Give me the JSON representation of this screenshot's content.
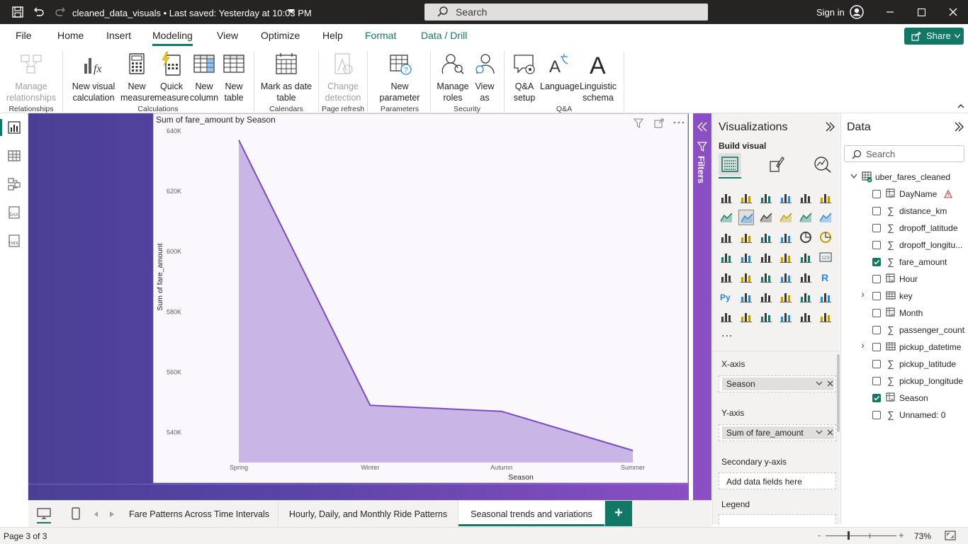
{
  "titlebar": {
    "title": "cleaned_data_visuals • Last saved: Yesterday at 10:03 PM",
    "search_placeholder": "Search",
    "signin": "Sign in"
  },
  "ribbon": {
    "tabs": [
      "File",
      "Home",
      "Insert",
      "Modeling",
      "View",
      "Optimize",
      "Help",
      "Format",
      "Data / Drill"
    ],
    "active_tab": "Modeling",
    "share": "Share",
    "buttons": {
      "manage_relationships": "Manage relationships",
      "new_visual_calc": "New visual calculation",
      "new_measure": "New measure",
      "quick_measure": "Quick measure",
      "new_column": "New column",
      "new_table": "New table",
      "mark_date": "Mark as date table",
      "change_detection": "Change detection",
      "new_parameter": "New parameter",
      "manage_roles": "Manage roles",
      "view_as": "View as",
      "qa_setup": "Q&A setup",
      "language": "Language",
      "linguistic_schema": "Linguistic schema"
    },
    "groups": {
      "relationships": "Relationships",
      "calculations": "Calculations",
      "calendars": "Calendars",
      "page_refresh": "Page refresh",
      "parameters": "Parameters",
      "security": "Security",
      "qa": "Q&A"
    }
  },
  "filters_label": "Filters",
  "chart_data": {
    "type": "area",
    "title": "Sum of fare_amount by Season",
    "xlabel": "Season",
    "ylabel": "Sum of fare_amount",
    "categories": [
      "Spring",
      "Winter",
      "Autumn",
      "Summer"
    ],
    "values": [
      637000,
      549000,
      547000,
      534000
    ],
    "ylim": [
      530000,
      640000
    ],
    "yticks": [
      540000,
      560000,
      580000,
      600000,
      620000,
      640000
    ],
    "ytick_labels": [
      "540K",
      "560K",
      "580K",
      "600K",
      "620K",
      "640K"
    ],
    "line_color": "#7b4bc4",
    "fill_color": "#c9b6e6",
    "grid": false
  },
  "visualizations": {
    "title": "Visualizations",
    "build_visual": "Build visual",
    "more": "...",
    "x_axis_label": "X-axis",
    "x_axis_field": "Season",
    "y_axis_label": "Y-axis",
    "y_axis_field": "Sum of fare_amount",
    "secondary_label": "Secondary y-axis",
    "secondary_placeholder": "Add data fields here",
    "legend_label": "Legend"
  },
  "data_pane": {
    "title": "Data",
    "search_placeholder": "Search",
    "table": "uber_fares_cleaned",
    "fields": [
      {
        "name": "DayName",
        "checked": false,
        "type": "calc"
      },
      {
        "name": "distance_km",
        "checked": false,
        "type": "sum"
      },
      {
        "name": "dropoff_latitude",
        "checked": false,
        "type": "sum"
      },
      {
        "name": "dropoff_longitu...",
        "checked": false,
        "type": "sum"
      },
      {
        "name": "fare_amount",
        "checked": true,
        "type": "sum"
      },
      {
        "name": "Hour",
        "checked": false,
        "type": "calc"
      },
      {
        "name": "key",
        "checked": false,
        "type": "table"
      },
      {
        "name": "Month",
        "checked": false,
        "type": "calc"
      },
      {
        "name": "passenger_count",
        "checked": false,
        "type": "sum"
      },
      {
        "name": "pickup_datetime",
        "checked": false,
        "type": "table"
      },
      {
        "name": "pickup_latitude",
        "checked": false,
        "type": "sum"
      },
      {
        "name": "pickup_longitude",
        "checked": false,
        "type": "sum"
      },
      {
        "name": "Season",
        "checked": true,
        "type": "calc"
      },
      {
        "name": "Unnamed: 0",
        "checked": false,
        "type": "sum"
      }
    ]
  },
  "pages": [
    "Fare Patterns Across Time Intervals",
    "Hourly, Daily, and Monthly Ride Patterns",
    "Seasonal trends and variations"
  ],
  "active_page": "Seasonal trends and variations",
  "status": {
    "page": "Page 3 of 3",
    "zoom": "73%"
  }
}
